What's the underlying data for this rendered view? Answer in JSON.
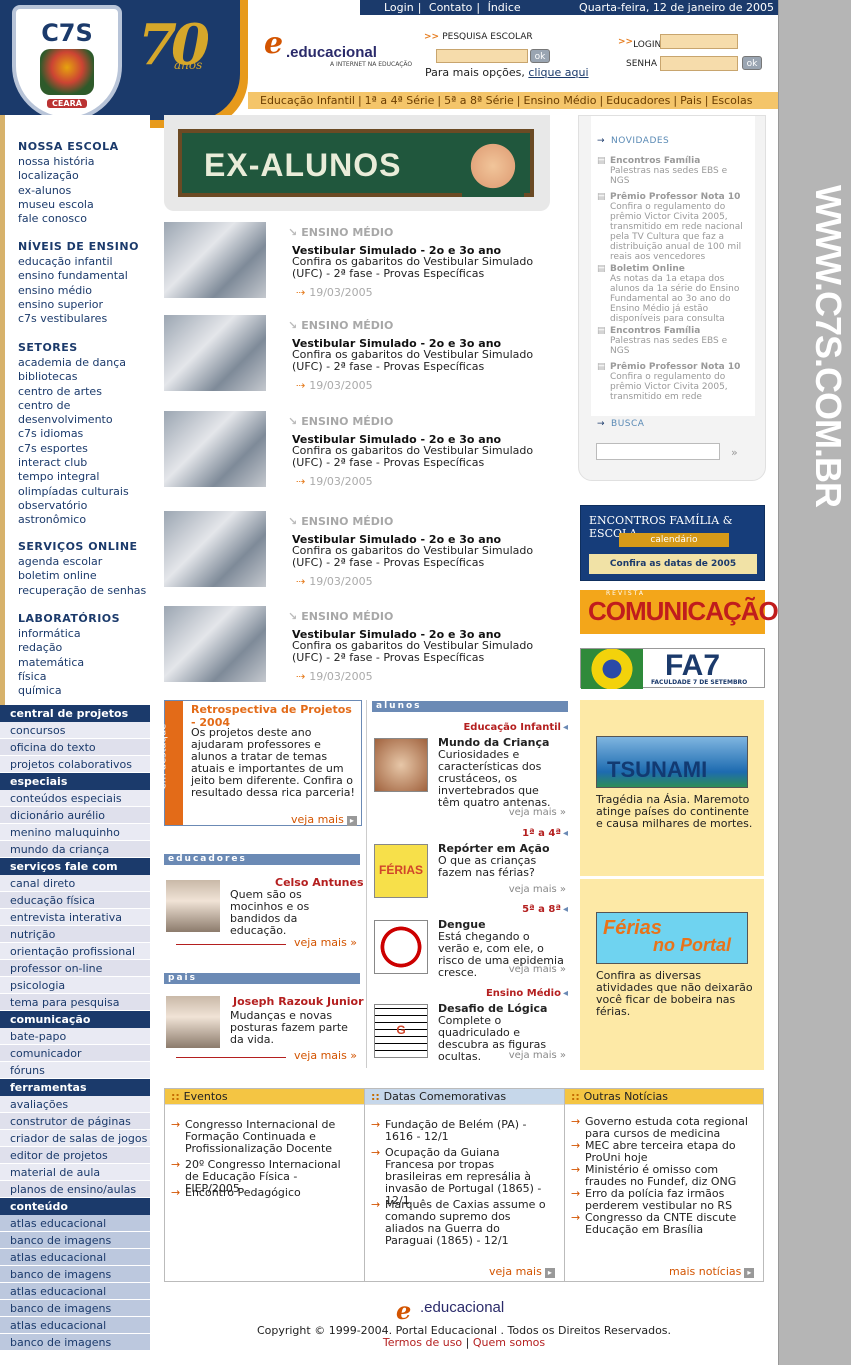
{
  "header": {
    "shield": {
      "text": "C7S",
      "state": "CEARÁ"
    },
    "anniversary": {
      "number": "70",
      "word": "anos"
    },
    "top_links": [
      "Login",
      "Contato",
      "Índice"
    ],
    "date": "Quarta-feira, 12 de janeiro de 2005",
    "edu_logo": {
      "e": "e",
      "name": ".educacional",
      "tagline": "A INTERNET NA EDUCAÇÃO"
    },
    "search": {
      "label": "PESQUISA ESCOLAR",
      "ok": "ok",
      "more_prefix": "Para mais opções,",
      "more_link": "clique aqui"
    },
    "login": {
      "login_label": "LOGIN",
      "senha_label": "SENHA",
      "ok": "ok"
    },
    "nav": [
      "Educação Infantil",
      "1ª a 4ª Série",
      "5ª a 8ª Série",
      "Ensino Médio",
      "Educadores",
      "Pais",
      "Escolas"
    ]
  },
  "sidebar": {
    "groups": [
      {
        "title": "NOSSA ESCOLA",
        "items": [
          "nossa história",
          "localização",
          "ex-alunos",
          "museu escola",
          "fale conosco"
        ]
      },
      {
        "title": "NÍVEIS DE ENSINO",
        "items": [
          "educação infantil",
          "ensino fundamental",
          "ensino médio",
          "ensino superior",
          "c7s vestibulares"
        ]
      },
      {
        "title": "SETORES",
        "items": [
          "academia de dança",
          "bibliotecas",
          "centro de artes",
          "centro de",
          "desenvolvimento",
          "c7s idiomas",
          "c7s esportes",
          "interact club",
          "tempo integral",
          "olimpíadas culturais",
          "observatório",
          "astronômico"
        ]
      },
      {
        "title": "SERVIÇOS ONLINE",
        "items": [
          "agenda escolar",
          "boletim online",
          "recuperação de senhas"
        ]
      },
      {
        "title": "LABORATÓRIOS",
        "items": [
          "informática",
          "redação",
          "matemática",
          "física",
          "química"
        ]
      }
    ],
    "blocks": [
      {
        "title": "central de projetos",
        "items": [
          "concursos",
          "oficina do texto",
          "projetos colaborativos"
        ]
      },
      {
        "title": "especiais",
        "items": [
          "conteúdos especiais",
          "dicionário aurélio",
          "menino maluquinho",
          "mundo da criança"
        ]
      },
      {
        "title": "serviços fale com",
        "items": [
          "canal direto",
          "educação física",
          "entrevista interativa",
          "nutrição",
          "orientação profissional",
          "professor on-line",
          "psicologia",
          "tema para pesquisa"
        ]
      },
      {
        "title": "comunicação",
        "items": [
          "bate-papo",
          "comunicador",
          "fóruns"
        ]
      },
      {
        "title": "ferramentas",
        "items": [
          "avaliações",
          "construtor de páginas",
          "criador de salas de jogos",
          "editor de projetos",
          "material de aula",
          "planos de ensino/aulas"
        ]
      },
      {
        "title": "conteúdo",
        "items": [
          "atlas educacional",
          "banco de imagens",
          "atlas educacional",
          "banco de imagens",
          "atlas educacional",
          "banco de imagens",
          "atlas educacional",
          "banco de imagens"
        ]
      }
    ]
  },
  "banner": {
    "text": "EX-ALUNOS"
  },
  "news": [
    {
      "category": "ENSINO MÉDIO",
      "title": "Vestibular Simulado - 2o e 3o ano",
      "desc": "Confira os gabaritos do Vestibular Simulado (UFC) - 2ª fase - Provas Específicas",
      "date": "19/03/2005"
    },
    {
      "category": "ENSINO MÉDIO",
      "title": "Vestibular Simulado - 2o e 3o ano",
      "desc": "Confira os gabaritos do Vestibular Simulado (UFC) - 2ª fase - Provas Específicas",
      "date": "19/03/2005"
    },
    {
      "category": "ENSINO MÉDIO",
      "title": "Vestibular Simulado - 2o e 3o ano",
      "desc": "Confira os gabaritos do Vestibular Simulado (UFC) - 2ª fase - Provas Específicas",
      "date": "19/03/2005"
    },
    {
      "category": "ENSINO MÉDIO",
      "title": "Vestibular Simulado - 2o e 3o ano",
      "desc": "Confira os gabaritos do Vestibular Simulado (UFC) - 2ª fase - Provas Específicas",
      "date": "19/03/2005"
    },
    {
      "category": "ENSINO MÉDIO",
      "title": "Vestibular Simulado - 2o e 3o ano",
      "desc": "Confira os gabaritos do Vestibular Simulado (UFC) - 2ª fase - Provas Específicas",
      "date": "19/03/2005"
    }
  ],
  "novidades": {
    "title": "NOVIDADES",
    "items": [
      {
        "title": "Encontros Família",
        "desc": "Palestras nas sedes EBS e NGS"
      },
      {
        "title": "Prêmio Professor Nota 10",
        "desc": "Confira o regulamento do prêmio Victor Civita 2005, transmitido em rede nacional pela TV Cultura que faz a distribuição anual de 100 mil reais aos vencedores"
      },
      {
        "title": "Boletim Online",
        "desc": "As notas da 1a etapa dos alunos da 1a série do Ensino Fundamental ao 3o ano do Ensino Médio já estão disponíveis para consulta"
      },
      {
        "title": "Encontros Família",
        "desc": "Palestras nas sedes EBS e NGS"
      },
      {
        "title": "Prêmio Professor Nota 10",
        "desc": "Confira o regulamento do prêmio Victor Civita 2005, transmitido em rede"
      }
    ],
    "busca": "BUSCA",
    "busca_go": "»"
  },
  "ads": {
    "ad1": {
      "title": "ENCONTROS FAMÍLIA & ESCOLA",
      "sub": "calendário",
      "cta": "Confira as datas de 2005"
    },
    "ad2": {
      "text": "COMUNICAÇÃO",
      "small": "REVISTA"
    },
    "ad3": {
      "text": "FA7",
      "sub": "FACULDADE 7 DE SETEMBRO"
    }
  },
  "destaque": {
    "side": "em destaque",
    "title": "Retrospectiva de Projetos - 2004",
    "desc": "Os projetos deste ano ajudaram professores e alunos a tratar de temas atuais e importantes de um jeito bem diferente. Confira o resultado dessa rica parceria!",
    "more": "veja mais"
  },
  "educadores": {
    "header": "educadores",
    "name": "Celso Antunes",
    "desc": "Quem são os mocinhos e os bandidos da educação.",
    "more": "veja mais »"
  },
  "pais": {
    "header": "pais",
    "name": "Joseph Razouk Junior",
    "desc": "Mudanças e novas posturas fazem parte da vida.",
    "more": "veja mais »"
  },
  "alunos": {
    "header": "alunos",
    "items": [
      {
        "level": "Educação Infantil",
        "title": "Mundo da Criança",
        "desc": "Curiosidades e características dos crustáceos, os invertebrados que têm quatro antenas.",
        "more": "veja mais »",
        "img_text": ""
      },
      {
        "level": "1ª a 4ª",
        "title": "Repórter em Ação",
        "desc": "O que as crianças fazem nas férias?",
        "more": "veja mais »",
        "img_text": "FÉRIAS"
      },
      {
        "level": "5ª a 8ª",
        "title": "Dengue",
        "desc": "Está chegando o verão e, com ele, o risco de uma epidemia cresce.",
        "more": "veja mais »",
        "img_text": ""
      },
      {
        "level": "Ensino Médio",
        "title": "Desafio de Lógica",
        "desc": "Complete o quadriculado e descubra as figuras ocultas.",
        "more": "veja mais »",
        "img_text": "G"
      }
    ]
  },
  "yellow": {
    "tsunami": {
      "img": "TSUNAMI",
      "desc": "Tragédia na Ásia. Maremoto atinge países do continente e causa milhares de mortes."
    },
    "ferias": {
      "img_a": "Férias",
      "img_b": "no Portal",
      "desc": "Confira as diversas atividades que não deixarão você ficar de bobeira nas férias."
    }
  },
  "bottom": {
    "eventos": {
      "title": "Eventos",
      "items": [
        "Congresso Internacional de Formação Continuada e Profissionalização Docente",
        "20º Congresso Internacional de Educação Física - FIEP/2005",
        "Encontro Pedagógico"
      ]
    },
    "datas": {
      "title": "Datas Comemorativas",
      "items": [
        "Fundação de Belém (PA) - 1616 - 12/1",
        "Ocupação da Guiana Francesa por tropas brasileiras em represália à invasão de Portugal (1865) - 12/1",
        "Marquês de Caxias assume o comando supremo dos aliados na Guerra do Paraguai (1865) - 12/1"
      ],
      "more": "veja mais"
    },
    "noticias": {
      "title": "Outras Notícias",
      "items": [
        "Governo estuda cota regional para cursos de medicina",
        "MEC abre terceira etapa do ProUni hoje",
        "Ministério é omisso com fraudes no Fundef, diz ONG",
        "Erro da polícia faz irmãos perderem vestibular no RS",
        "Congresso da CNTE discute Educação em Brasília"
      ],
      "more": "mais notícias"
    }
  },
  "footer": {
    "e": "e",
    "name": ".educacional",
    "copyright": "Copyright © 1999-2004. Portal Educacional . Todos os Direitos Reservados.",
    "terms": "Termos de uso",
    "about": "Quem somos"
  },
  "rightbar": {
    "url": "WWW.C7S.COM.BR"
  },
  "colors": {
    "navy": "#1b3a6b",
    "orange": "#e79a1c",
    "red": "#b41f1f",
    "yellow": "#fde9a6"
  }
}
